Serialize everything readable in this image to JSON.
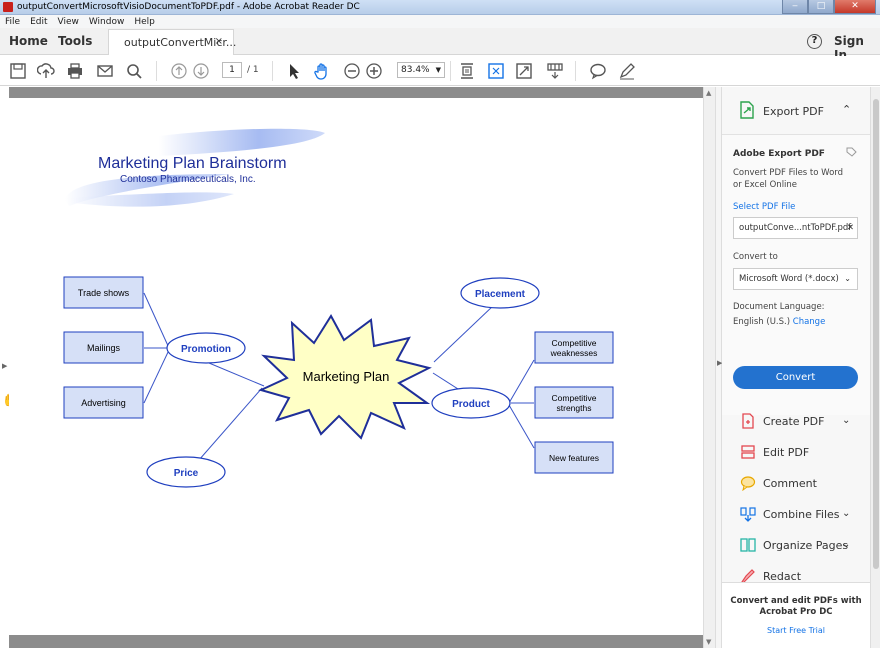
{
  "window": {
    "title": "outputConvertMicrosoftVisioDocumentToPDF.pdf - Adobe Acrobat Reader DC"
  },
  "menu": [
    "File",
    "Edit",
    "View",
    "Window",
    "Help"
  ],
  "tabs": {
    "home": "Home",
    "tools": "Tools",
    "doc": "outputConvertMicr...",
    "doc_close": "×",
    "help": "?",
    "signin": "Sign In"
  },
  "toolbar": {
    "icons": [
      "save-icon",
      "upload-icon",
      "print-icon",
      "email-icon",
      "search-icon",
      "prev-page-icon",
      "next-page-icon",
      "select-icon",
      "hand-icon",
      "zoom-out-icon",
      "zoom-in-icon",
      "fit-page-icon",
      "marquee-icon",
      "fullscreen-icon",
      "scroll-mode-icon",
      "comment-icon",
      "sign-icon"
    ],
    "page_current": "1",
    "page_total": "/ 1",
    "zoom": "83.4%"
  },
  "diagram": {
    "title": "Marketing Plan Brainstorm",
    "subtitle": "Contoso Pharmaceuticals, Inc.",
    "center": "Marketing Plan",
    "promotion": "Promotion",
    "placement": "Placement",
    "product": "Product",
    "price": "Price",
    "trade_shows": "Trade shows",
    "mailings": "Mailings",
    "advertising": "Advertising",
    "comp_weak_1": "Competitive",
    "comp_weak_2": "weaknesses",
    "comp_str_1": "Competitive",
    "comp_str_2": "strengths",
    "new_features": "New features",
    "colors": {
      "node_stroke": "#1f3fbf",
      "node_text": "#1f3fbf",
      "box_fill": "#d6e0f7",
      "star_fill": "#ffffc6"
    }
  },
  "right_panel": {
    "export_header": "Export PDF",
    "export_chevron": "⌃",
    "title": "Adobe Export PDF",
    "description": "Convert PDF Files to Word or Excel Online",
    "select_link": "Select PDF File",
    "file_name": "outputConve...ntToPDF.pdf",
    "convert_to_label": "Convert to",
    "format": "Microsoft Word (*.docx)",
    "doc_lang_label": "Document Language:",
    "doc_lang_value": "English (U.S.)",
    "change_link": "Change",
    "convert_button": "Convert",
    "tools": [
      {
        "label": "Create PDF",
        "chevron": "⌄",
        "icon": "create-pdf-icon",
        "color": "#e34850"
      },
      {
        "label": "Edit PDF",
        "chevron": "",
        "icon": "edit-pdf-icon",
        "color": "#e34850"
      },
      {
        "label": "Comment",
        "chevron": "",
        "icon": "comment-icon",
        "color": "#e8a800"
      },
      {
        "label": "Combine Files",
        "chevron": "⌄",
        "icon": "combine-files-icon",
        "color": "#1473e6"
      },
      {
        "label": "Organize Pages",
        "chevron": "⌄",
        "icon": "organize-pages-icon",
        "color": "#26b5a6"
      },
      {
        "label": "Redact",
        "chevron": "",
        "icon": "redact-icon",
        "color": "#e34850"
      }
    ],
    "promo_text": "Convert and edit PDFs with Acrobat Pro DC",
    "trial_link": "Start Free Trial"
  }
}
